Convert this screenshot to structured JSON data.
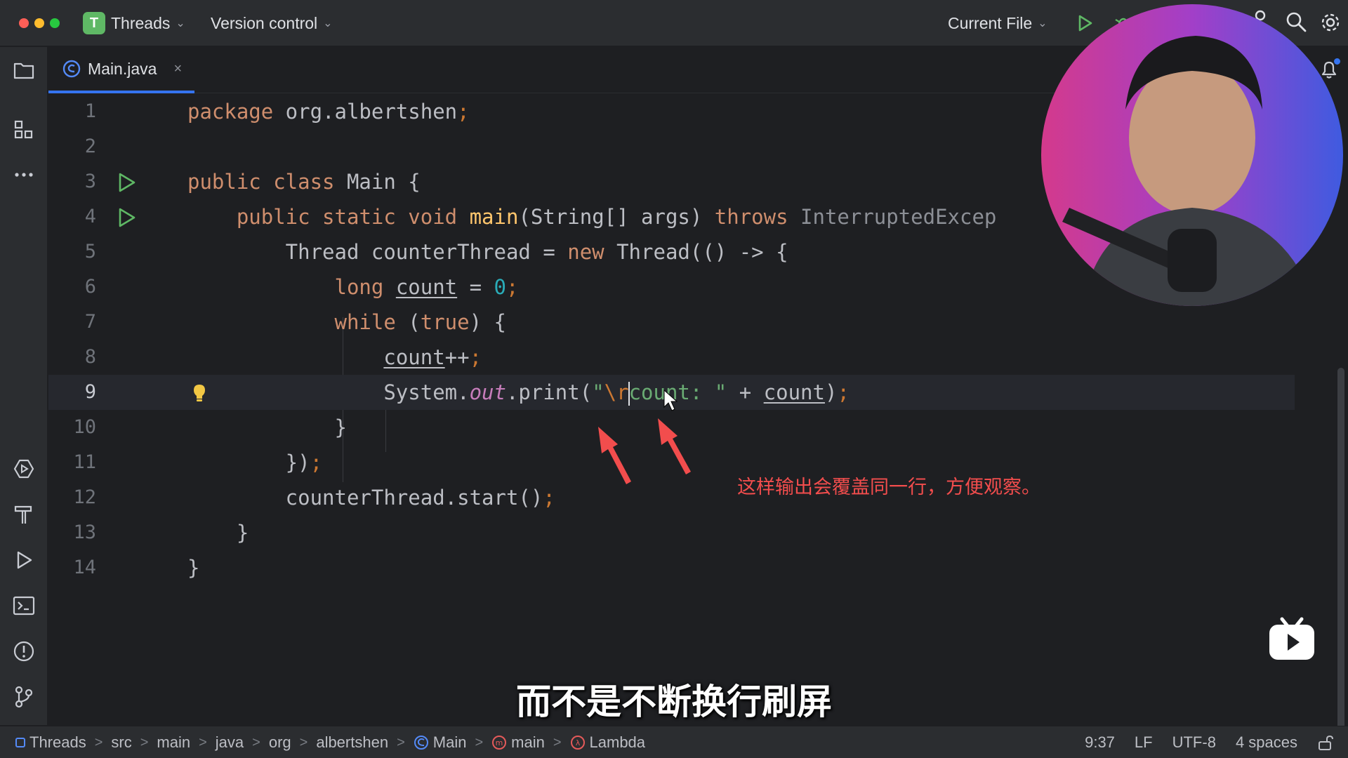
{
  "titlebar": {
    "project_badge": "T",
    "project_name": "Threads",
    "vcs_label": "Version control",
    "run_config": "Current File"
  },
  "tabs": [
    {
      "label": "Main.java",
      "close": "×"
    }
  ],
  "editor": {
    "line_numbers": [
      "1",
      "2",
      "3",
      "4",
      "5",
      "6",
      "7",
      "8",
      "9",
      "10",
      "11",
      "12",
      "13",
      "14"
    ],
    "current_line": 9
  },
  "annotation_text": "这样输出会覆盖同一行，方便观察。",
  "subtitle": "而不是不断换行刷屏",
  "breadcrumbs": [
    {
      "label": "Threads",
      "icon": "module-icon"
    },
    {
      "label": "src"
    },
    {
      "label": "main"
    },
    {
      "label": "java"
    },
    {
      "label": "org"
    },
    {
      "label": "albertshen"
    },
    {
      "label": "Main",
      "icon": "class-icon"
    },
    {
      "label": "main",
      "icon": "method-icon"
    },
    {
      "label": "Lambda",
      "icon": "lambda-icon"
    }
  ],
  "breadcrumb_separator": ">",
  "status": {
    "caret_position": "9:37",
    "line_separator": "LF",
    "encoding": "UTF-8",
    "indent": "4 spaces"
  },
  "colors": {
    "accent": "#3574f0",
    "keyword": "#cf8e6d",
    "string": "#6aab73",
    "number": "#2aacb8",
    "annotation_red": "#f24d4d"
  }
}
